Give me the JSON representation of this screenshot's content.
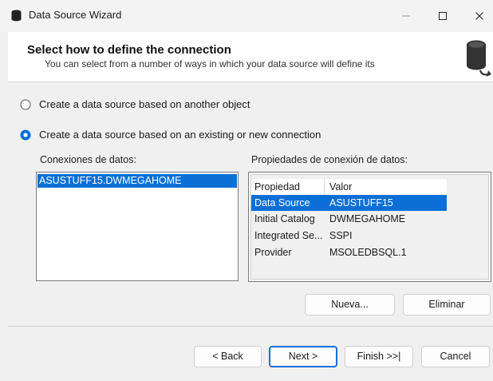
{
  "window": {
    "title": "Data Source Wizard"
  },
  "header": {
    "title": "Select how to define the connection",
    "subtitle": "You can select from a number of ways in which your data source will define its"
  },
  "options": {
    "another_object": "Create a data source based on another object",
    "existing_connection": "Create a data source based on an existing or new connection",
    "selected": "existing_connection"
  },
  "connections": {
    "label": "Conexiones de datos:",
    "items": [
      "ASUSTUFF15.DWMEGAHOME"
    ],
    "selected_index": 0
  },
  "properties": {
    "label": "Propiedades de conexión de datos:",
    "columns": [
      "Propiedad",
      "Valor"
    ],
    "rows": [
      {
        "name": "Data Source",
        "value": "ASUSTUFF15"
      },
      {
        "name": "Initial Catalog",
        "value": "DWMEGAHOME"
      },
      {
        "name": "Integrated Se...",
        "value": "SSPI"
      },
      {
        "name": "Provider",
        "value": "MSOLEDBSQL.1"
      }
    ],
    "selected_index": 0
  },
  "actions": {
    "new_label": "Nueva...",
    "delete_label": "Eliminar"
  },
  "nav": {
    "back_label": "< Back",
    "next_label": "Next >",
    "finish_label": "Finish >>|",
    "cancel_label": "Cancel"
  },
  "colors": {
    "selection": "#0a6fd6",
    "window_bg": "#f0f0f0"
  }
}
